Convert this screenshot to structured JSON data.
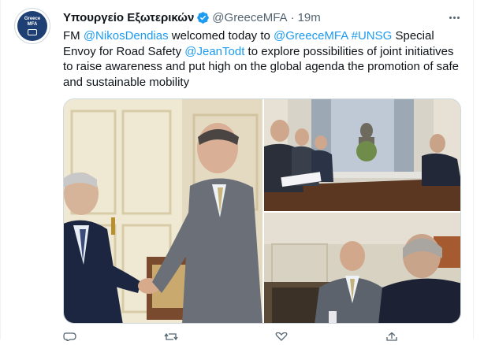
{
  "tweet": {
    "author_name": "Υπουργείο Εξωτερικών",
    "handle": "@GreeceMFA",
    "separator": "·",
    "time": "19m",
    "avatar_text_line1": "Greece",
    "avatar_text_line2": "MFA",
    "text_parts": [
      {
        "text": "FM ",
        "link": false
      },
      {
        "text": "@NikosDendias",
        "link": true
      },
      {
        "text": " welcomed today to ",
        "link": false
      },
      {
        "text": "@GreeceMFA",
        "link": true
      },
      {
        "text": " ",
        "link": false
      },
      {
        "text": "#UNSG",
        "link": true
      },
      {
        "text": " Special Envoy for Road Safety ",
        "link": false
      },
      {
        "text": "@JeanTodt",
        "link": true
      },
      {
        "text": " to explore possibilities of joint initiatives to raise awareness and put high on the global agenda the promotion of safe and sustainable mobility",
        "link": false
      }
    ],
    "photos": [
      {
        "name": "handshake-photo",
        "icon": "photo-handshake"
      },
      {
        "name": "meeting-table-photo",
        "icon": "photo-meeting"
      },
      {
        "name": "seated-conversation-photo",
        "icon": "photo-conversation"
      }
    ],
    "actions": [
      {
        "name": "reply-icon"
      },
      {
        "name": "retweet-icon"
      },
      {
        "name": "like-icon"
      },
      {
        "name": "share-icon"
      }
    ]
  },
  "colors": {
    "link": "#1d9bf0",
    "text": "#0f1419",
    "muted": "#536471",
    "verified": "#1d9bf0",
    "avatar_bg": "#1d3f73"
  }
}
